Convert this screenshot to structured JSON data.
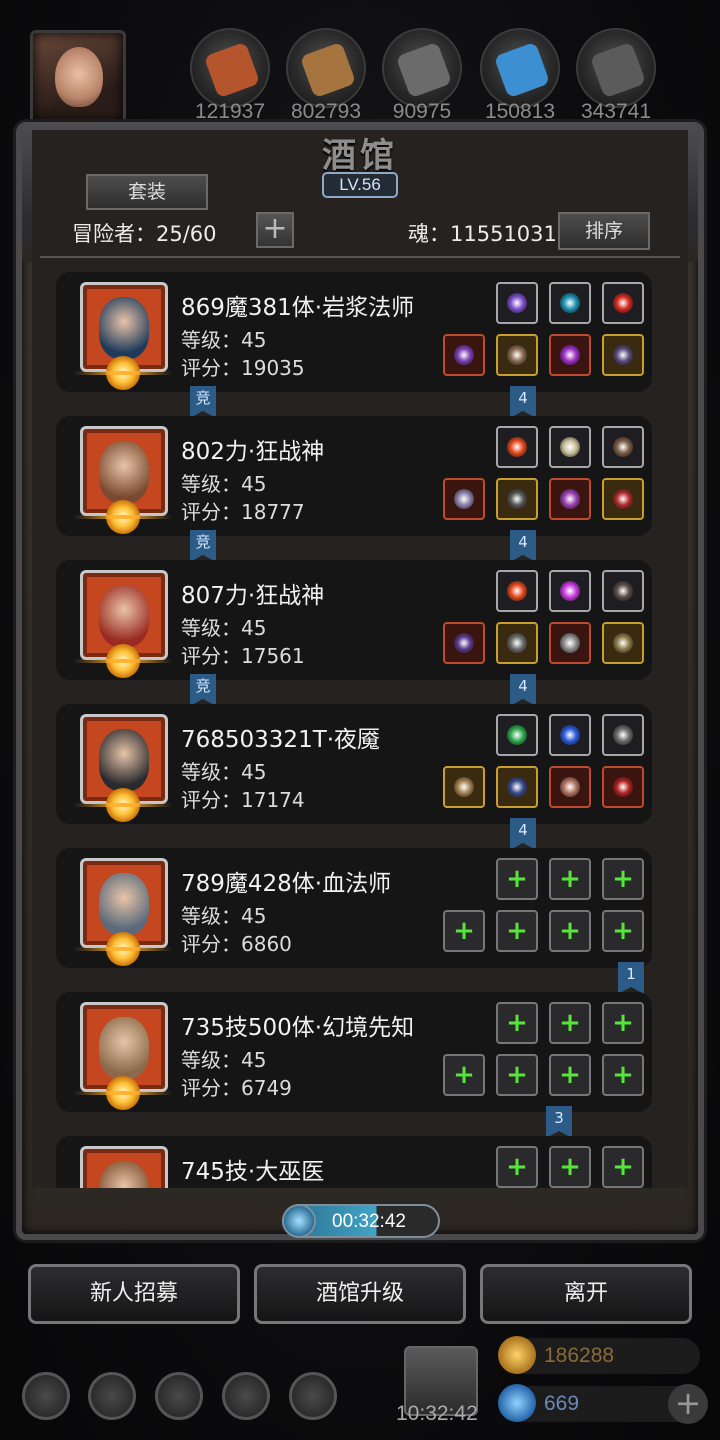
{
  "resources": [
    {
      "icon": "meat-icon",
      "value": "121937",
      "color": "#b5552e"
    },
    {
      "icon": "wood-icon",
      "value": "802793",
      "color": "#a6743e"
    },
    {
      "icon": "stone-icon",
      "value": "90975",
      "color": "#6b6b6b"
    },
    {
      "icon": "crystal-icon",
      "value": "150813",
      "color": "#3c8fd1"
    },
    {
      "icon": "iron-icon",
      "value": "343741",
      "color": "#5b5b5b"
    }
  ],
  "tavern": {
    "title": "酒馆",
    "level": "LV.56",
    "set_button": "套装",
    "adventurers_label": "冒险者：25/60",
    "add_symbol": "+",
    "soul_label": "魂：11551031",
    "sort_button": "排序"
  },
  "heroes": [
    {
      "name": "869魔381体·岩浆法师",
      "level": "等级：45",
      "score": "评分：19035",
      "face": "#1e3a5a",
      "arena": "竞",
      "badge": "4",
      "slots_top": [
        {
          "kind": "plain",
          "gem": "#7a4ec9",
          "icon": "orb-icon"
        },
        {
          "kind": "plain",
          "gem": "#1b8fb0",
          "icon": "amulet-icon"
        },
        {
          "kind": "plain",
          "gem": "#d0281f",
          "icon": "ring-icon"
        }
      ],
      "slots_bottom": [
        {
          "kind": "red",
          "gem": "#7b3fb0",
          "icon": "staff-icon"
        },
        {
          "kind": "gold",
          "gem": "#8a6a52",
          "icon": "robe-icon"
        },
        {
          "kind": "red",
          "gem": "#9c2fc4",
          "icon": "pendant-icon"
        },
        {
          "kind": "gold",
          "gem": "#5a4a7a",
          "icon": "cloak-icon"
        }
      ]
    },
    {
      "name": "802力·狂战神",
      "level": "等级：45",
      "score": "评分：18777",
      "face": "#7a4a30",
      "arena": "竞",
      "badge": "4",
      "slots_top": [
        {
          "kind": "plain",
          "gem": "#e2481b",
          "icon": "fire-icon"
        },
        {
          "kind": "plain",
          "gem": "#c8c09a",
          "icon": "fang-icon"
        },
        {
          "kind": "plain",
          "gem": "#7a5a44",
          "icon": "claw-icon"
        }
      ],
      "slots_bottom": [
        {
          "kind": "red",
          "gem": "#8b7fa8",
          "icon": "axe-icon"
        },
        {
          "kind": "gold",
          "gem": "#555",
          "icon": "armor-icon"
        },
        {
          "kind": "red",
          "gem": "#9a3fb0",
          "icon": "helmet-icon"
        },
        {
          "kind": "gold",
          "gem": "#b02a2a",
          "icon": "gauntlet-icon"
        }
      ]
    },
    {
      "name": "807力·狂战神",
      "level": "等级：45",
      "score": "评分：17561",
      "face": "#9a2a22",
      "arena": "竞",
      "badge": "4",
      "slots_top": [
        {
          "kind": "plain",
          "gem": "#e2481b",
          "icon": "fire-icon"
        },
        {
          "kind": "plain",
          "gem": "#c83ae0",
          "icon": "gem-icon"
        },
        {
          "kind": "plain",
          "gem": "#5a4a44",
          "icon": "feather-icon"
        }
      ],
      "slots_bottom": [
        {
          "kind": "red",
          "gem": "#5a3a8a",
          "icon": "mace-icon"
        },
        {
          "kind": "gold",
          "gem": "#6a6a6a",
          "icon": "armor-icon"
        },
        {
          "kind": "red",
          "gem": "#8a8a8a",
          "icon": "helmet-icon"
        },
        {
          "kind": "gold",
          "gem": "#8a7a4a",
          "icon": "bracer-icon"
        }
      ]
    },
    {
      "name": "768503321T·夜魇",
      "level": "等级：45",
      "score": "评分：17174",
      "face": "#2a2a2e",
      "arena": "",
      "badge": "4",
      "slots_top": [
        {
          "kind": "plain",
          "gem": "#2ea84e",
          "icon": "emerald-icon"
        },
        {
          "kind": "plain",
          "gem": "#2a5ad8",
          "icon": "dagger-icon"
        },
        {
          "kind": "plain",
          "gem": "#6a6a6a",
          "icon": "shuriken-icon"
        }
      ],
      "slots_bottom": [
        {
          "kind": "gold",
          "gem": "#a08050",
          "icon": "bow-icon"
        },
        {
          "kind": "gold",
          "gem": "#3a4a8a",
          "icon": "shield-icon"
        },
        {
          "kind": "red",
          "gem": "#b07060",
          "icon": "mask-icon"
        },
        {
          "kind": "red",
          "gem": "#b02020",
          "icon": "ring-icon"
        }
      ]
    },
    {
      "name": "789魔428体·血法师",
      "level": "等级：45",
      "score": "评分：6860",
      "face": "#5a6a7a",
      "arena": "",
      "badge": "1",
      "slots_top": [
        {
          "kind": "empty"
        },
        {
          "kind": "empty"
        },
        {
          "kind": "empty"
        }
      ],
      "slots_bottom": [
        {
          "kind": "empty"
        },
        {
          "kind": "empty"
        },
        {
          "kind": "empty"
        },
        {
          "kind": "empty"
        }
      ]
    },
    {
      "name": "735技500体·幻境先知",
      "level": "等级：45",
      "score": "评分：6749",
      "face": "#8a6a4a",
      "arena": "",
      "badge": "3",
      "slots_top": [
        {
          "kind": "empty"
        },
        {
          "kind": "empty"
        },
        {
          "kind": "empty"
        }
      ],
      "slots_bottom": [
        {
          "kind": "empty"
        },
        {
          "kind": "empty"
        },
        {
          "kind": "empty"
        },
        {
          "kind": "empty"
        }
      ]
    },
    {
      "name": "745技·大巫医",
      "level": "",
      "score": "",
      "face": "#7a4a2a",
      "arena": "",
      "badge": "",
      "slots_top": [
        {
          "kind": "empty"
        },
        {
          "kind": "empty"
        },
        {
          "kind": "empty"
        }
      ],
      "slots_bottom": []
    }
  ],
  "timer": "00:32:42",
  "actions": {
    "recruit": "新人招募",
    "upgrade": "酒馆升级",
    "leave": "离开"
  },
  "bottom_bar": {
    "gift_timer": "10:32:42",
    "gold": "186288",
    "diamond": "669",
    "plus": "+"
  }
}
